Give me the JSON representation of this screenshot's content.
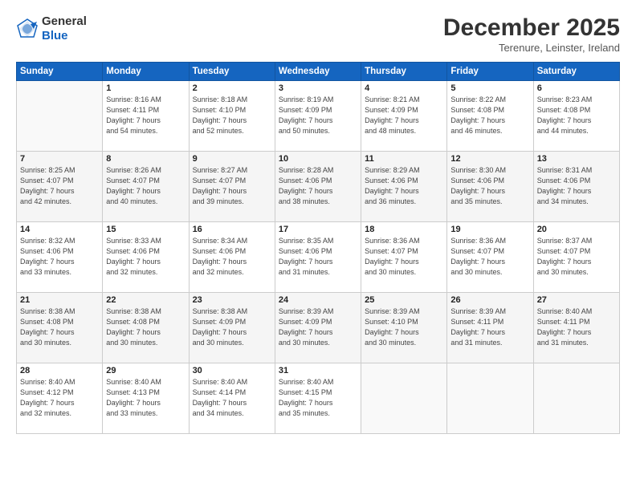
{
  "header": {
    "logo": {
      "general": "General",
      "blue": "Blue"
    },
    "title": "December 2025",
    "location": "Terenure, Leinster, Ireland"
  },
  "weekdays": [
    "Sunday",
    "Monday",
    "Tuesday",
    "Wednesday",
    "Thursday",
    "Friday",
    "Saturday"
  ],
  "weeks": [
    [
      {
        "day": "",
        "info": ""
      },
      {
        "day": "1",
        "info": "Sunrise: 8:16 AM\nSunset: 4:11 PM\nDaylight: 7 hours\nand 54 minutes."
      },
      {
        "day": "2",
        "info": "Sunrise: 8:18 AM\nSunset: 4:10 PM\nDaylight: 7 hours\nand 52 minutes."
      },
      {
        "day": "3",
        "info": "Sunrise: 8:19 AM\nSunset: 4:09 PM\nDaylight: 7 hours\nand 50 minutes."
      },
      {
        "day": "4",
        "info": "Sunrise: 8:21 AM\nSunset: 4:09 PM\nDaylight: 7 hours\nand 48 minutes."
      },
      {
        "day": "5",
        "info": "Sunrise: 8:22 AM\nSunset: 4:08 PM\nDaylight: 7 hours\nand 46 minutes."
      },
      {
        "day": "6",
        "info": "Sunrise: 8:23 AM\nSunset: 4:08 PM\nDaylight: 7 hours\nand 44 minutes."
      }
    ],
    [
      {
        "day": "7",
        "info": "Sunrise: 8:25 AM\nSunset: 4:07 PM\nDaylight: 7 hours\nand 42 minutes."
      },
      {
        "day": "8",
        "info": "Sunrise: 8:26 AM\nSunset: 4:07 PM\nDaylight: 7 hours\nand 40 minutes."
      },
      {
        "day": "9",
        "info": "Sunrise: 8:27 AM\nSunset: 4:07 PM\nDaylight: 7 hours\nand 39 minutes."
      },
      {
        "day": "10",
        "info": "Sunrise: 8:28 AM\nSunset: 4:06 PM\nDaylight: 7 hours\nand 38 minutes."
      },
      {
        "day": "11",
        "info": "Sunrise: 8:29 AM\nSunset: 4:06 PM\nDaylight: 7 hours\nand 36 minutes."
      },
      {
        "day": "12",
        "info": "Sunrise: 8:30 AM\nSunset: 4:06 PM\nDaylight: 7 hours\nand 35 minutes."
      },
      {
        "day": "13",
        "info": "Sunrise: 8:31 AM\nSunset: 4:06 PM\nDaylight: 7 hours\nand 34 minutes."
      }
    ],
    [
      {
        "day": "14",
        "info": "Sunrise: 8:32 AM\nSunset: 4:06 PM\nDaylight: 7 hours\nand 33 minutes."
      },
      {
        "day": "15",
        "info": "Sunrise: 8:33 AM\nSunset: 4:06 PM\nDaylight: 7 hours\nand 32 minutes."
      },
      {
        "day": "16",
        "info": "Sunrise: 8:34 AM\nSunset: 4:06 PM\nDaylight: 7 hours\nand 32 minutes."
      },
      {
        "day": "17",
        "info": "Sunrise: 8:35 AM\nSunset: 4:06 PM\nDaylight: 7 hours\nand 31 minutes."
      },
      {
        "day": "18",
        "info": "Sunrise: 8:36 AM\nSunset: 4:07 PM\nDaylight: 7 hours\nand 30 minutes."
      },
      {
        "day": "19",
        "info": "Sunrise: 8:36 AM\nSunset: 4:07 PM\nDaylight: 7 hours\nand 30 minutes."
      },
      {
        "day": "20",
        "info": "Sunrise: 8:37 AM\nSunset: 4:07 PM\nDaylight: 7 hours\nand 30 minutes."
      }
    ],
    [
      {
        "day": "21",
        "info": "Sunrise: 8:38 AM\nSunset: 4:08 PM\nDaylight: 7 hours\nand 30 minutes."
      },
      {
        "day": "22",
        "info": "Sunrise: 8:38 AM\nSunset: 4:08 PM\nDaylight: 7 hours\nand 30 minutes."
      },
      {
        "day": "23",
        "info": "Sunrise: 8:38 AM\nSunset: 4:09 PM\nDaylight: 7 hours\nand 30 minutes."
      },
      {
        "day": "24",
        "info": "Sunrise: 8:39 AM\nSunset: 4:09 PM\nDaylight: 7 hours\nand 30 minutes."
      },
      {
        "day": "25",
        "info": "Sunrise: 8:39 AM\nSunset: 4:10 PM\nDaylight: 7 hours\nand 30 minutes."
      },
      {
        "day": "26",
        "info": "Sunrise: 8:39 AM\nSunset: 4:11 PM\nDaylight: 7 hours\nand 31 minutes."
      },
      {
        "day": "27",
        "info": "Sunrise: 8:40 AM\nSunset: 4:11 PM\nDaylight: 7 hours\nand 31 minutes."
      }
    ],
    [
      {
        "day": "28",
        "info": "Sunrise: 8:40 AM\nSunset: 4:12 PM\nDaylight: 7 hours\nand 32 minutes."
      },
      {
        "day": "29",
        "info": "Sunrise: 8:40 AM\nSunset: 4:13 PM\nDaylight: 7 hours\nand 33 minutes."
      },
      {
        "day": "30",
        "info": "Sunrise: 8:40 AM\nSunset: 4:14 PM\nDaylight: 7 hours\nand 34 minutes."
      },
      {
        "day": "31",
        "info": "Sunrise: 8:40 AM\nSunset: 4:15 PM\nDaylight: 7 hours\nand 35 minutes."
      },
      {
        "day": "",
        "info": ""
      },
      {
        "day": "",
        "info": ""
      },
      {
        "day": "",
        "info": ""
      }
    ]
  ]
}
